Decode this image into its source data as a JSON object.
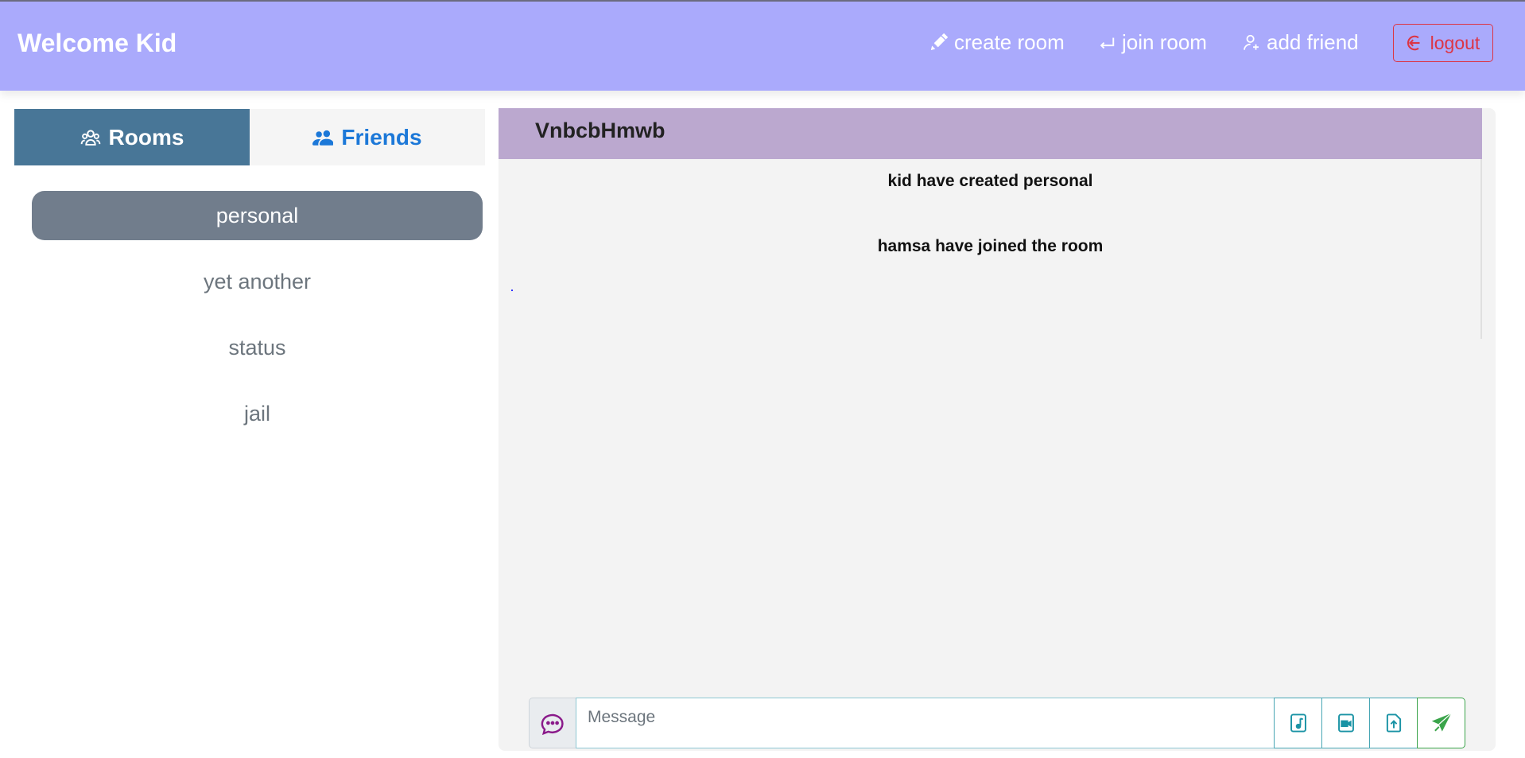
{
  "navbar": {
    "brand": "Welcome Kid",
    "create_room": "create room",
    "join_room": "join room",
    "add_friend": "add friend",
    "logout": "logout"
  },
  "tabs": {
    "rooms": "Rooms",
    "friends": "Friends"
  },
  "rooms": [
    {
      "label": "personal",
      "active": true
    },
    {
      "label": "yet another",
      "active": false
    },
    {
      "label": "status",
      "active": false
    },
    {
      "label": "jail",
      "active": false
    }
  ],
  "chat": {
    "title": "VnbcbHmwb",
    "messages": [
      "kid have created personal",
      "hamsa have joined the room"
    ],
    "input_placeholder": "Message"
  },
  "colors": {
    "navbar": "#aaaafc",
    "rooms_tab": "#487697",
    "friends_tab_text": "#1c78d8",
    "active_room": "#717d8c",
    "chat_header": "#bba8cf",
    "logout": "#dc3545",
    "send": "#3aa44a",
    "action_buttons": "#1a93a5"
  },
  "icons": {
    "create_room": "pencil-icon",
    "join_room": "enter-icon",
    "add_friend": "person-add-icon",
    "logout": "logout-icon",
    "rooms_tab": "people-icon",
    "friends_tab": "people-fill-icon",
    "chat": "chat-dots-icon",
    "audio": "file-music-icon",
    "video": "file-video-icon",
    "upload": "upload-icon",
    "send": "send-icon"
  }
}
